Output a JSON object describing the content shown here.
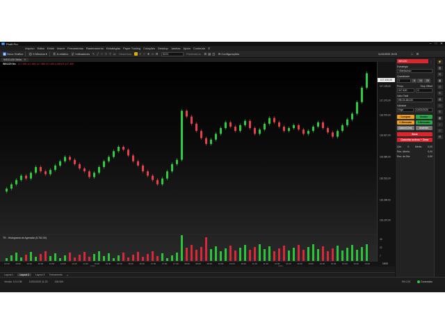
{
  "app": {
    "title": "Profit Pro"
  },
  "menu": [
    "Arquivo",
    "Editar",
    "Exibir",
    "Inserir",
    "Ferramentas",
    "Rastreamento",
    "Estratégias",
    "Paper Trading",
    "Cotações",
    "Desktop",
    "Janelas",
    "Ajuda",
    "Conteúdo"
  ],
  "toolbar": {
    "new_chart": "Novo Gráfico",
    "period": "5 Minutos",
    "autoscale": "A.relativo",
    "indicators": "Indicadores",
    "drawings": "Desenhos",
    "symbol": "BOV",
    "params": "Parâmetros",
    "config": "Configurações"
  },
  "datetime": "11/02/2020 15:03",
  "chart": {
    "tab": "WDOJ20 5Min",
    "ohlc": "WINJ20 5m",
    "ohlc_values": "117.395  117.490  117.380  117.420  0,06%  R 117.450",
    "price_tag": "117.420,00",
    "subpanel_label": "TR - Histograma de Agressão (5.762,00)",
    "y_ticks": [
      "117.125,00",
      "117.270,00",
      "116.976,00",
      "116.827,00",
      "116.680,00",
      "116.531,00",
      "116.384,00",
      "116.237,00"
    ],
    "sub_ticks": [
      "40",
      "22",
      "7"
    ],
    "x_ticks": [
      "10:10",
      "12:00",
      "12:10",
      "12:30",
      "13:50",
      "14:00",
      "14:20",
      "14:40",
      "15:20",
      "15:40",
      "16:00",
      "16:20",
      "16:40",
      "17:00",
      "17:20",
      "17:40",
      "09:00",
      "09:20",
      "09:40",
      "10:00",
      "10:20",
      "10:40",
      "11:20",
      "11:40",
      "12:00",
      "12:20",
      "12:40",
      "13:00",
      "13:20",
      "13:40",
      "14:00",
      "14:20",
      "14:40"
    ],
    "x_sub": [
      "11/fev",
      "12/fev"
    ],
    "x_corner": "15:00",
    "colors": {
      "up": "#2ecc40",
      "down": "#e8414e",
      "vol_up": "#2bc43b",
      "vol_down": "#d8283a"
    }
  },
  "chart_data": {
    "type": "line",
    "title": "",
    "series": [
      {
        "values": [
          116.46,
          116.49,
          116.52,
          116.55,
          116.53,
          116.57,
          116.61,
          116.58,
          116.56,
          116.59,
          116.62,
          116.65,
          116.68,
          116.66,
          116.63,
          116.6,
          116.58,
          116.54,
          116.57,
          116.61,
          116.65,
          116.68,
          116.72,
          116.75,
          116.73,
          116.69,
          116.65,
          116.62,
          116.58,
          116.55,
          116.52,
          116.49,
          116.53,
          116.58,
          116.63,
          116.66,
          117.0,
          116.96,
          116.91,
          116.86,
          116.81,
          116.77,
          116.8,
          116.84,
          116.88,
          116.92,
          116.89,
          116.86,
          116.9,
          116.93,
          116.88,
          116.84,
          116.87,
          116.91,
          116.95,
          116.92,
          116.89,
          116.86,
          116.88,
          116.9,
          116.87,
          116.84,
          116.86,
          116.89,
          116.92,
          116.88,
          116.85,
          116.82,
          116.86,
          116.9,
          116.94,
          116.98,
          117.06,
          117.16,
          117.26
        ]
      }
    ]
  },
  "panel": {
    "title": "WINJ20",
    "strategy_label": "Estratégia",
    "strategy_value": "<Nenhuma>",
    "qty_label": "Quantidade",
    "qty_value": "1",
    "qty_presets": [
      "5",
      "10",
      "25"
    ],
    "price_label": "Preço",
    "price_value": "117.420",
    "stop_label": "Stop Offset",
    "stop_value": "0",
    "total_label": "Valor Total",
    "total_value": "R$ 23.484,00",
    "validity_label": "Validade",
    "validity_value": "Hoje",
    "validity_date": "12/02/2020",
    "btn_buy": "Comprar",
    "btn_sell": "Vender",
    "btn_buy_mkt": "C.Mercado",
    "btn_sell_mkt": "V.Mercado",
    "btn_cancel": "Cancel.Ord.",
    "btn_invert": "Inverter",
    "btn_zero": "Zerar",
    "btn_cancel_zero": "Cancelar ordens + Zerar",
    "pos_label": "Qtd.",
    "pos_value": "0",
    "avg_label": "Médio",
    "avg_value": "0,00",
    "open_label": "Res. Aberto",
    "open_value": "0,00",
    "day_label": "Res. do Dia",
    "day_value": "0,00"
  },
  "layouts": [
    "Layout 1",
    "Layout 2",
    "Layout 3",
    "Treinamento"
  ],
  "status": {
    "version": "Versão: 5.0.0.98",
    "date": "12/02/2020  11:23",
    "latency": "165.909",
    "memory": "R$ 0,00",
    "connection": "Conectado"
  }
}
